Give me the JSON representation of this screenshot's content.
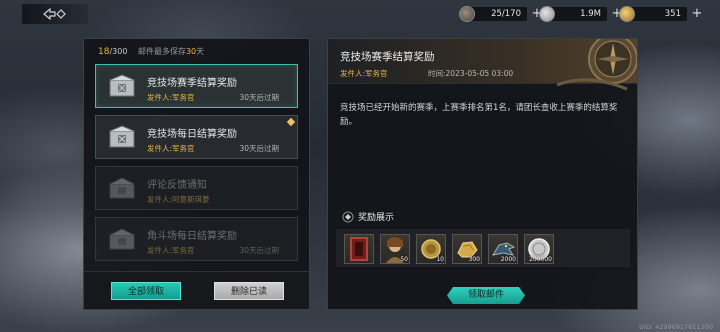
{
  "resources": [
    {
      "name": "gauntlet-icon",
      "value": "25/170"
    },
    {
      "name": "silver-coin-icon",
      "value": "1.9M"
    },
    {
      "name": "gold-coin-icon",
      "value": "351"
    }
  ],
  "inbox": {
    "count": "18",
    "capacity": "/300",
    "limit_prefix": "邮件最多保存",
    "limit_days": "30",
    "limit_suffix": "天",
    "mails": [
      {
        "title": "竞技场赛季结算奖励",
        "sender": "发件人:军务官",
        "expire": "30天后过期",
        "state": "selected"
      },
      {
        "title": "竞技场每日结算奖励",
        "sender": "发件人:军务官",
        "expire": "30天后过期",
        "state": "unread-new"
      },
      {
        "title": "评论反馈通知",
        "sender": "发件人:阿意斯琪菱",
        "expire": "",
        "state": "read"
      },
      {
        "title": "角斗场每日结算奖励",
        "sender": "发件人:军务官",
        "expire": "30天后过期",
        "state": "read"
      }
    ],
    "claim_all_label": "全部领取",
    "delete_read_label": "删除已读"
  },
  "detail": {
    "title": "竞技场赛季结算奖励",
    "sender": "发件人:军务官",
    "time": "时间:2023-05-05 03:00",
    "body": "竞技场已经开始新的赛季，上赛季排名第1名，请团长查收上赛季的结算奖励。",
    "rewards_label": "奖励展示",
    "rewards": [
      {
        "icon": "red-frame-icon",
        "qty": ""
      },
      {
        "icon": "portrait-icon",
        "qty": "50"
      },
      {
        "icon": "gold-medal-icon",
        "qty": "10"
      },
      {
        "icon": "gold-nugget-icon",
        "qty": "300"
      },
      {
        "icon": "dragon-head-icon",
        "qty": "2000"
      },
      {
        "icon": "silver-coin-icon",
        "qty": "200000"
      }
    ],
    "claim_label": "领取邮件"
  },
  "footer": {
    "uid": "UID: 42996917611200"
  },
  "colors": {
    "accent_teal": "#27c9b6",
    "gold_text": "#e7b548"
  }
}
